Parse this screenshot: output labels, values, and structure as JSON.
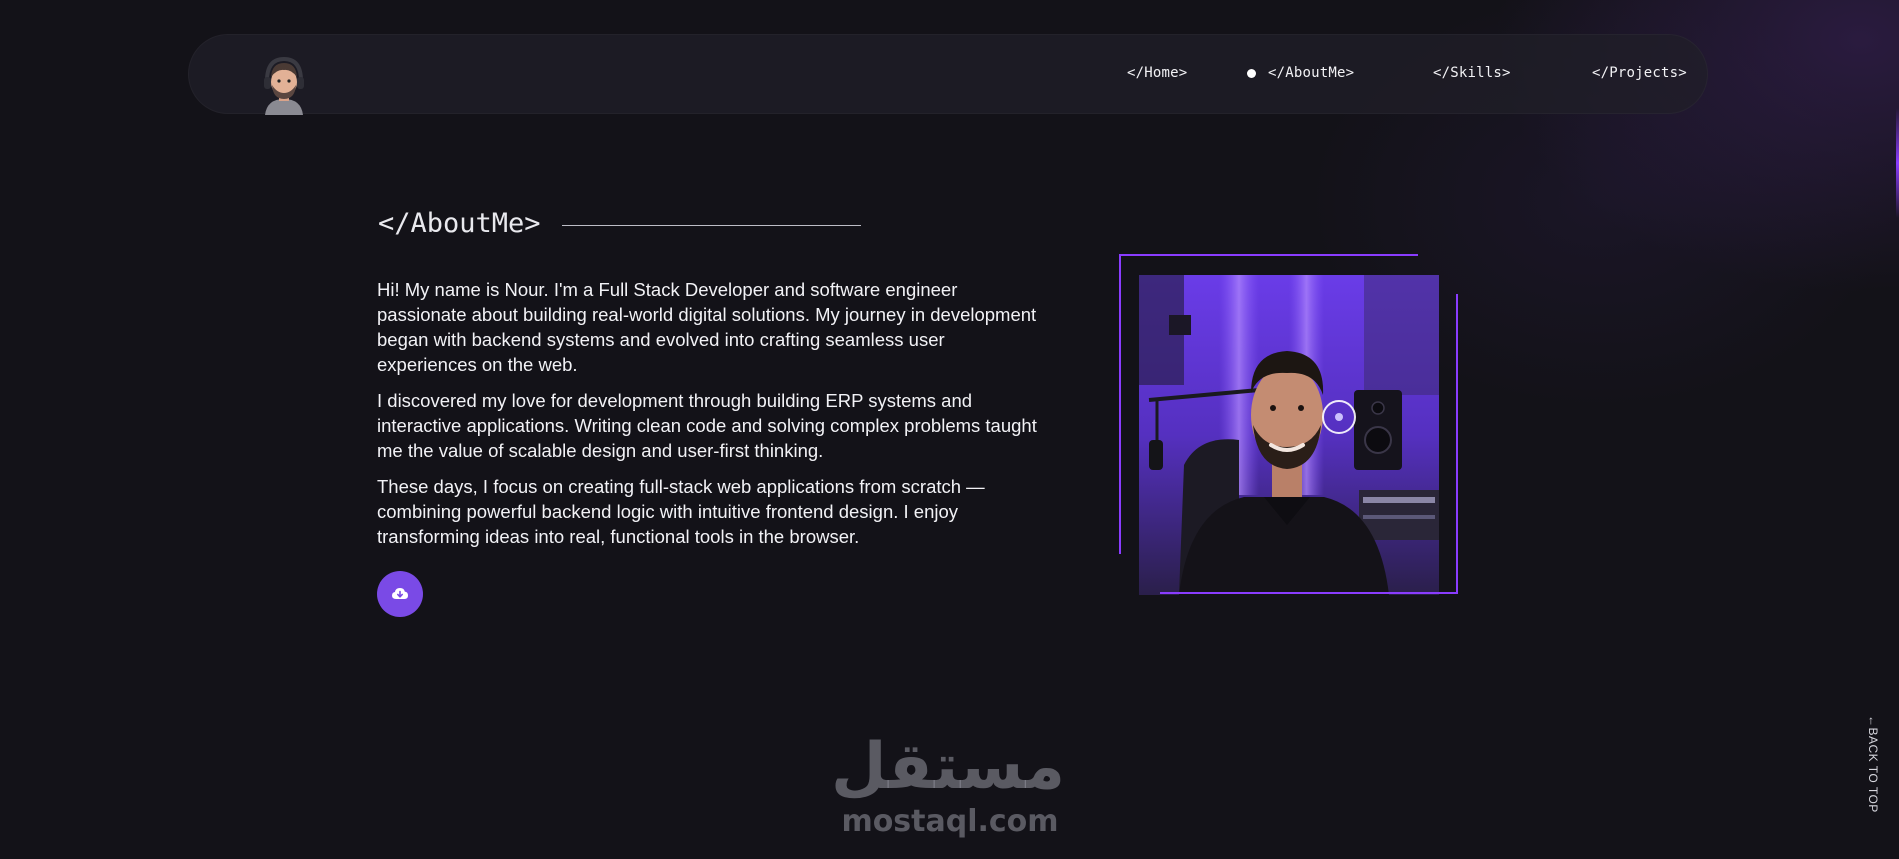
{
  "nav": {
    "avatar_icon": "avatar-icon",
    "links": [
      {
        "label": "</Home>"
      },
      {
        "label": "</AboutMe>",
        "active": true
      },
      {
        "label": "</Skills>"
      },
      {
        "label": "</Projects>"
      }
    ]
  },
  "about": {
    "title": "</AboutMe>",
    "paragraphs": [
      "Hi! My name is Nour. I'm a Full Stack Developer and software engineer passionate about building real-world digital solutions. My journey in development began with backend systems and evolved into crafting seamless user experiences on the web.",
      "I discovered my love for development through building ERP systems and interactive applications. Writing clean code and solving complex problems taught me the value of scalable design and user-first thinking.",
      "These days, I focus on creating full-stack web applications from scratch — combining powerful backend logic with intuitive frontend design. I enjoy transforming ideas into real, functional tools in the browser."
    ],
    "download_icon": "cloud-download-icon"
  },
  "watermark": {
    "arabic": "مستقل",
    "latin": "mostaql.com"
  },
  "back_to_top": "←BACK TO TOP",
  "colors": {
    "background": "#131218",
    "accent": "#7a4ae6",
    "frame": "#8a3cff"
  }
}
